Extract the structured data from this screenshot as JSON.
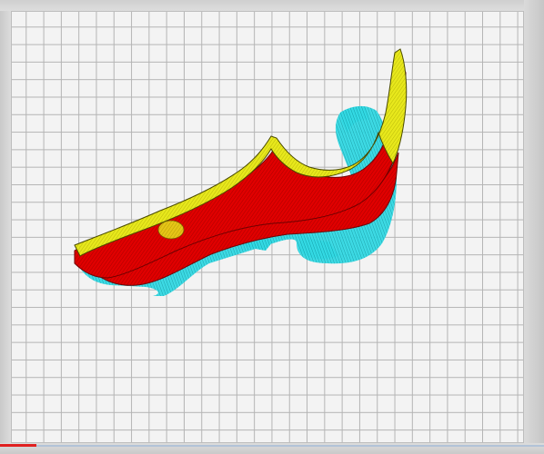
{
  "viewport": {
    "view": "layer-view",
    "colors": {
      "build_plate": "#f3f3f3",
      "grid_lines": "#b4b4b4",
      "outer_wall": "#e00000",
      "top_skin": "#e8e81c",
      "support": "#2ed6e0",
      "x_axis": "#e02020"
    }
  }
}
